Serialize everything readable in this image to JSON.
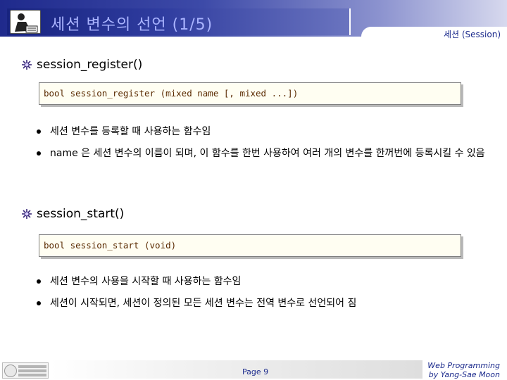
{
  "header": {
    "title": "세션 변수의 선언 (1/5)",
    "section": "세션 (Session)"
  },
  "sections": [
    {
      "heading": "session_register()",
      "code": "bool session_register (mixed name [, mixed ...])",
      "bullets": [
        "세션 변수를 등록할 때 사용하는 함수임",
        "name 은 세션 변수의 이름이 되며, 이 함수를 한번 사용하여 여러 개의 변수를 한꺼번에 등록시킬 수 있음"
      ]
    },
    {
      "heading": "session_start()",
      "code": "bool session_start (void)",
      "bullets": [
        "세션 변수의 사용을 시작할 때 사용하는 함수임",
        "세션이 시작되면, 세션이 정의된 모든 세션 변수는 전역 변수로 선언되어 짐"
      ]
    }
  ],
  "footer": {
    "page": "Page 9",
    "credit_line1": "Web Programming",
    "credit_line2": "by Yang-Sae Moon"
  },
  "colors": {
    "title_text": "#aab4ff",
    "accent": "#1b2a8c",
    "code_text": "#5a2a00"
  }
}
